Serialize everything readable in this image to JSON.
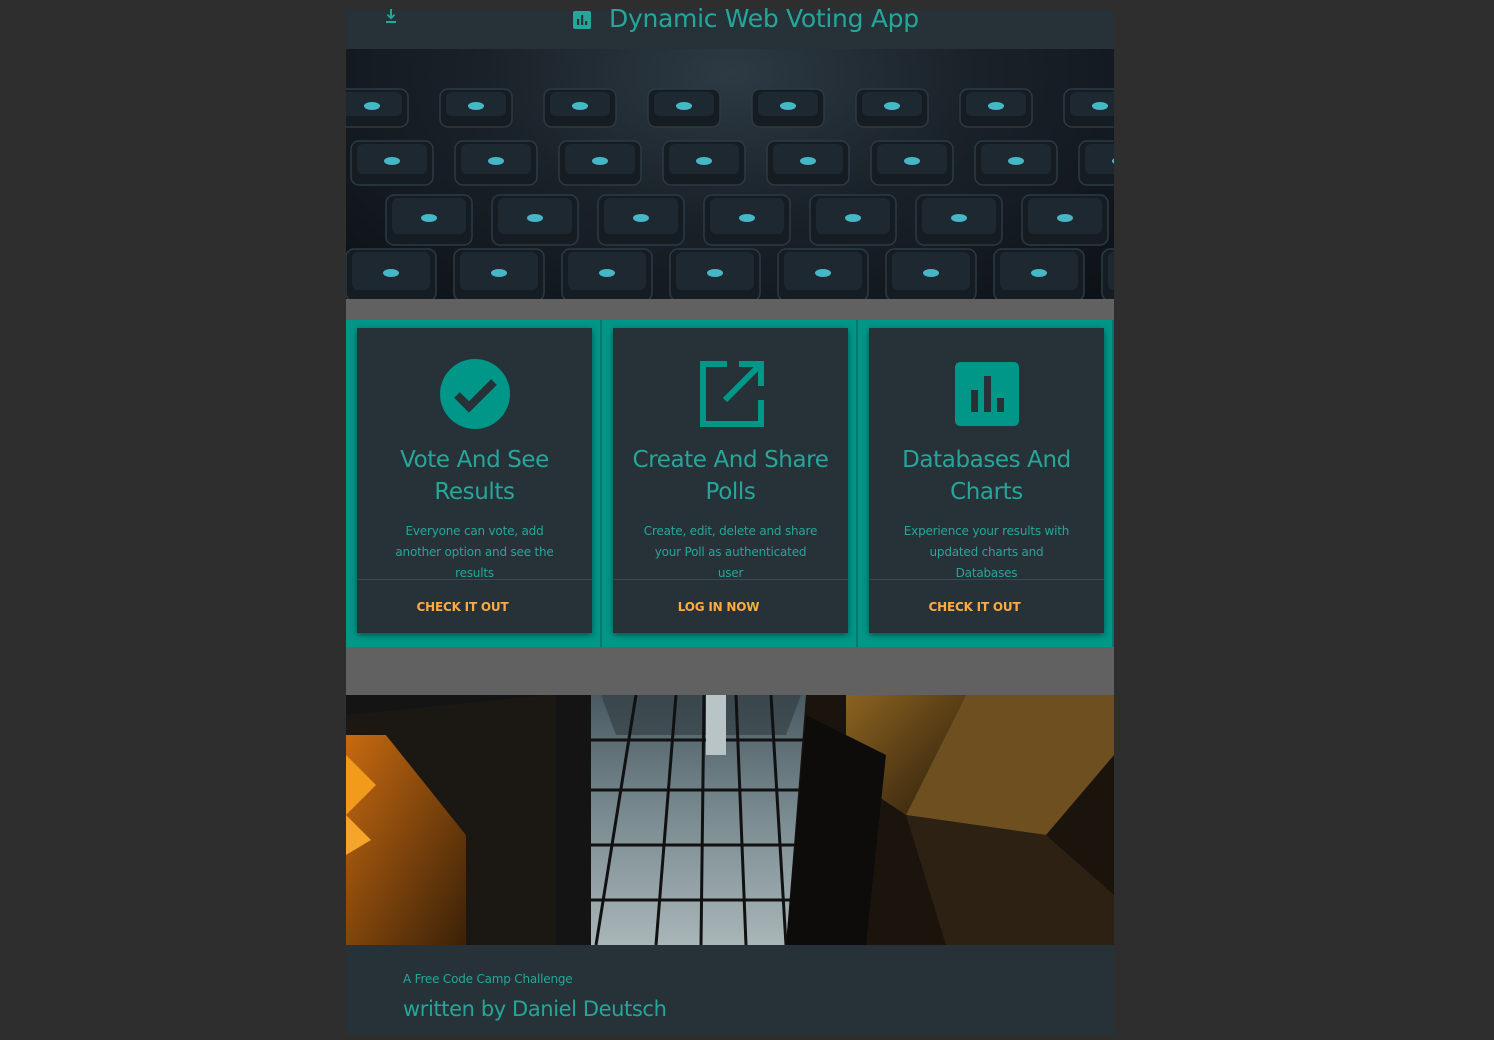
{
  "header": {
    "title": "Dynamic Web Voting App",
    "menu_icon": "download-icon",
    "logo_icon": "bar-chart-icon"
  },
  "hero_top": {
    "image": "keyboard-photo"
  },
  "features": [
    {
      "icon": "check-circle-icon",
      "title": "Vote And See Results",
      "description": "Everyone can vote, add another option and see the results",
      "action": "CHECK IT OUT"
    },
    {
      "icon": "open-in-new-icon",
      "title": "Create And Share Polls",
      "description": "Create, edit, delete and share your Poll as authenticated user",
      "action": "LOG IN NOW"
    },
    {
      "icon": "bar-chart-icon",
      "title": "Databases And Charts",
      "description": "Experience your results with updated charts and Databases",
      "action": "CHECK IT OUT"
    }
  ],
  "hero_bottom": {
    "image": "building-photo"
  },
  "footer": {
    "subtitle": "A Free Code Camp Challenge",
    "author": "written by Daniel Deutsch"
  },
  "colors": {
    "primary": "#26a69a",
    "teal_panel": "#009688",
    "card_bg": "#263238",
    "accent": "#ffab40",
    "page_bg": "#2e2e2e",
    "gray_band": "#616161"
  }
}
